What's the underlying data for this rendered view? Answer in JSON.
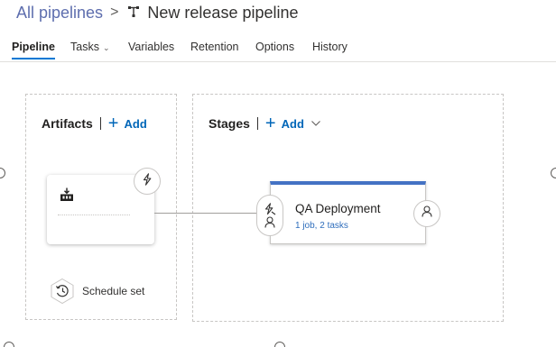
{
  "breadcrumb": {
    "root": "All pipelines",
    "separator": ">",
    "title": "New release pipeline"
  },
  "tabs": [
    {
      "label": "Pipeline",
      "active": true
    },
    {
      "label": "Tasks",
      "caret": "⌄"
    },
    {
      "label": "Variables"
    },
    {
      "label": "Retention"
    },
    {
      "label": "Options"
    },
    {
      "label": "History"
    }
  ],
  "artifacts": {
    "title": "Artifacts",
    "add_label": "Add",
    "card_icon": "build-icon",
    "trigger_icon": "lightning-icon"
  },
  "schedule": {
    "label": "Schedule set",
    "icon": "clock-icon"
  },
  "stages": {
    "title": "Stages",
    "add_label": "Add"
  },
  "stage": {
    "name": "QA Deployment",
    "subtitle": "1 job, 2 tasks",
    "accent": "#4472c4"
  },
  "colors": {
    "link": "#0066b8",
    "tab_underline": "#0078d4"
  }
}
